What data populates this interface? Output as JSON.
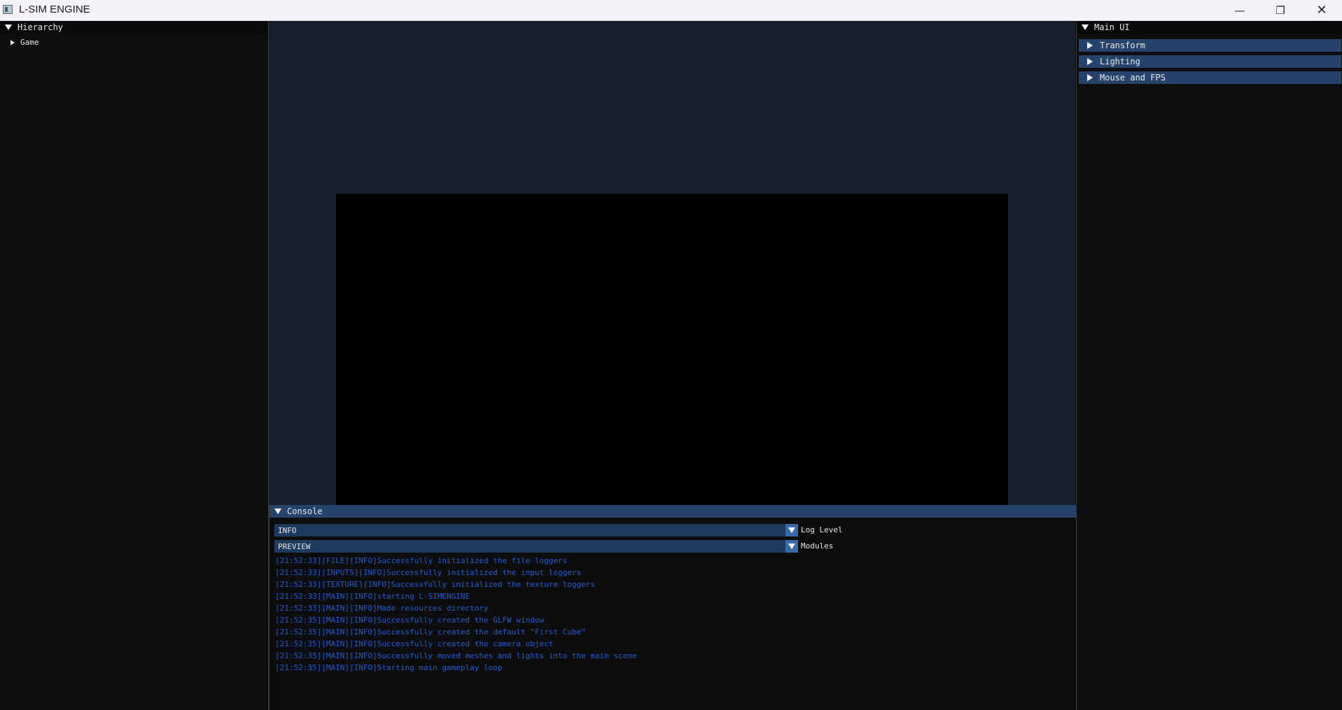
{
  "window": {
    "title": "L-SIM ENGINE",
    "minimize_glyph": "—",
    "maximize_glyph": "❐",
    "close_glyph": "✕"
  },
  "hierarchy": {
    "title": "Hierarchy",
    "items": [
      "Game"
    ]
  },
  "main_ui": {
    "title": "Main UI",
    "sections": [
      "Transform",
      "Lighting",
      "Mouse and FPS"
    ]
  },
  "console": {
    "title": "Console",
    "log_level": {
      "value": "INFO",
      "label": "Log Level"
    },
    "modules": {
      "value": "PREVIEW",
      "label": "Modules"
    },
    "lines": [
      "[21:52:33][FILE][INFO]Successfully initialized the file loggers",
      "[21:52:33][INPUTS][INFO]Successfully initialized the input loggers",
      "[21:52:33][TEXTURE][INFO]Successfully initialized the texture loggers",
      "[21:52:33][MAIN][INFO]starting L-SIMENGINE",
      "[21:52:33][MAIN][INFO]Made resources directory",
      "[21:52:35][MAIN][INFO]Successfully created the GLFW window",
      "[21:52:35][MAIN][INFO]Successfully created the default \"First Cube\"",
      "[21:52:35][MAIN][INFO]Successfully created the camera object",
      "[21:52:35][MAIN][INFO]Successfully moved meshes and lights into the main scene",
      "[21:52:35][MAIN][INFO]Starting main gameplay loop"
    ]
  },
  "colors": {
    "header_blue": "#26446b",
    "combo_blue": "#1e3a5e",
    "log_text": "#1e5bd6",
    "viewport_bg": "#14202c"
  }
}
